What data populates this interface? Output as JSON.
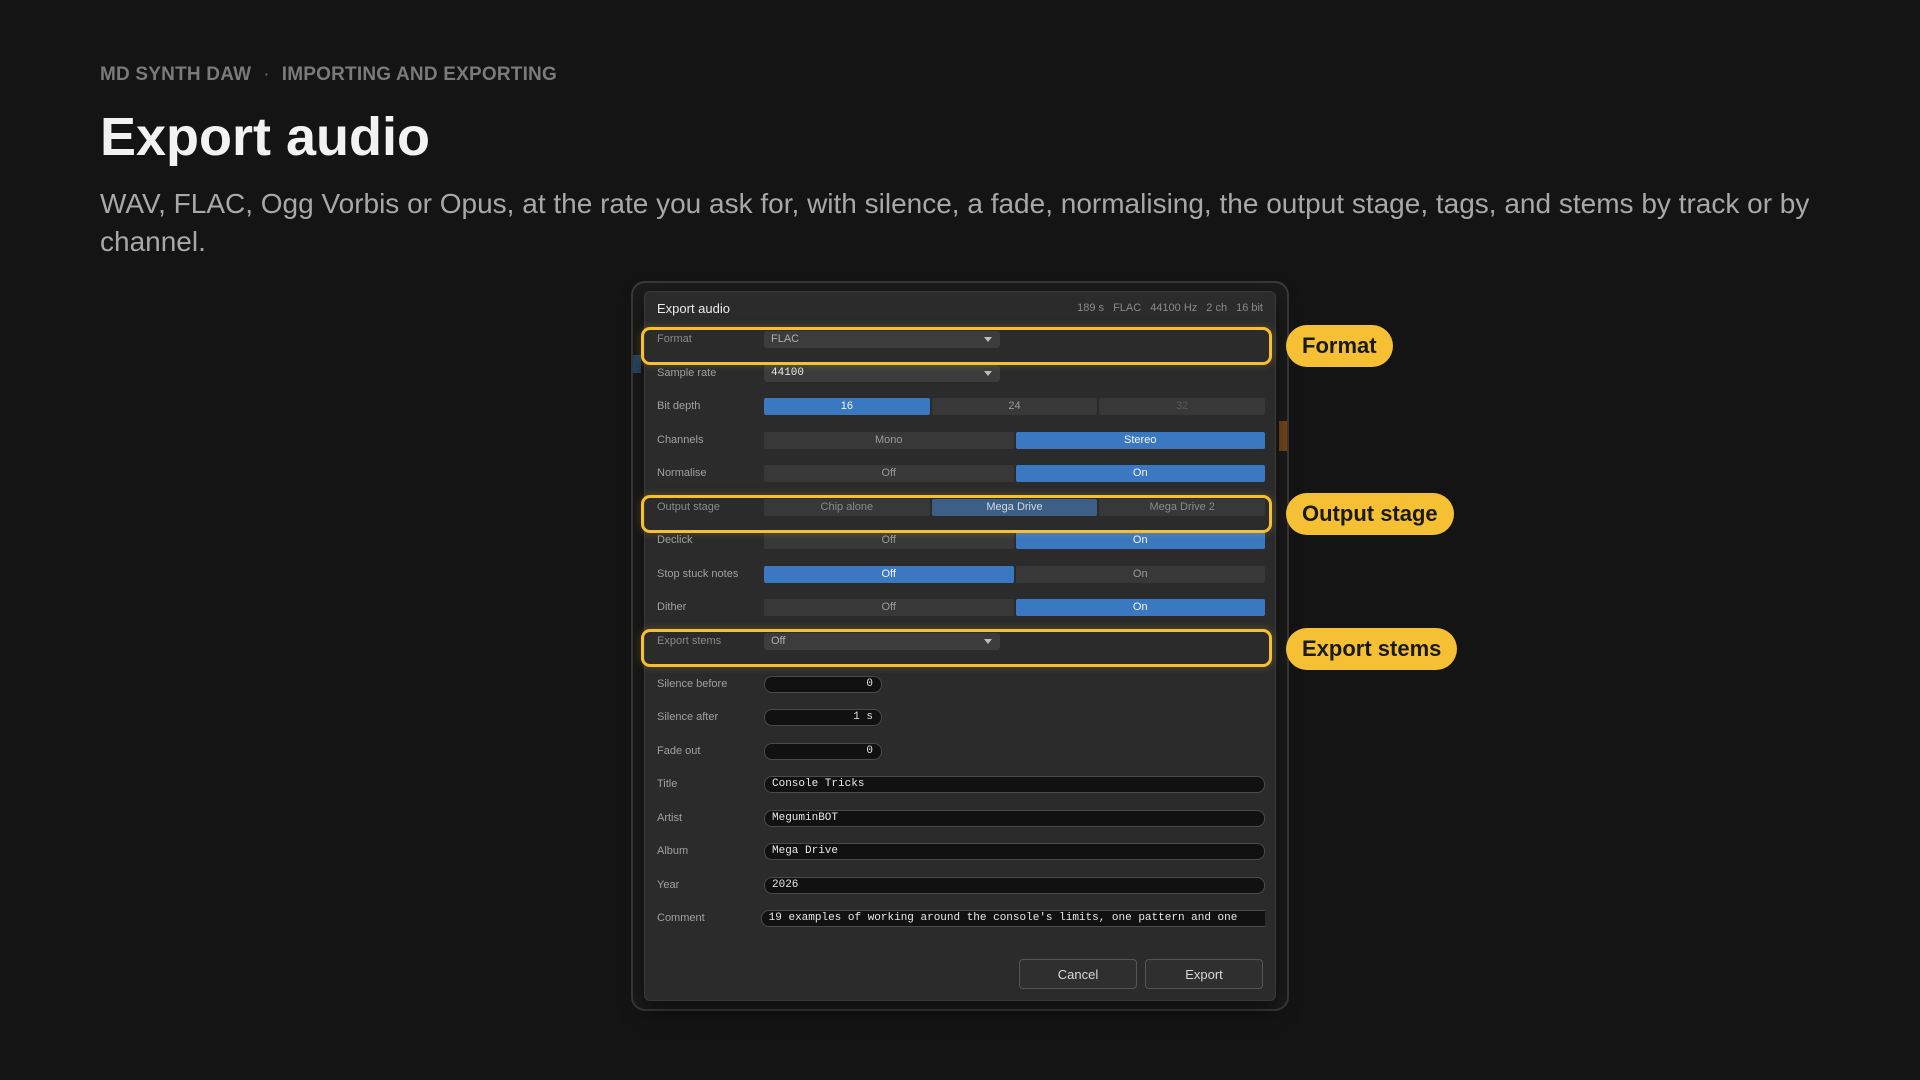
{
  "breadcrumb": {
    "app": "MD SYNTH DAW",
    "separator": "·",
    "section": "IMPORTING AND EXPORTING"
  },
  "page": {
    "title": "Export audio",
    "subtitle": "WAV, FLAC, Ogg Vorbis or Opus, at the rate you ask for, with silence, a fade, normalising, the output stage, tags, and stems by track or by channel."
  },
  "dialog": {
    "title": "Export audio",
    "meta": [
      "189 s",
      "FLAC",
      "44100 Hz",
      "2 ch",
      "16 bit"
    ],
    "format": {
      "label": "Format",
      "value": "FLAC"
    },
    "sample_rate": {
      "label": "Sample rate",
      "value": "44100"
    },
    "bit_depth": {
      "label": "Bit depth",
      "options": [
        "16",
        "24",
        "32"
      ],
      "selected": "16",
      "disabled": [
        "32"
      ]
    },
    "channels": {
      "label": "Channels",
      "options": [
        "Mono",
        "Stereo"
      ],
      "selected": "Stereo"
    },
    "normalise": {
      "label": "Normalise",
      "options": [
        "Off",
        "On"
      ],
      "selected": "On"
    },
    "output_stage": {
      "label": "Output stage",
      "options": [
        "Chip alone",
        "Mega Drive",
        "Mega Drive 2"
      ],
      "selected": "Mega Drive"
    },
    "declick": {
      "label": "Declick",
      "options": [
        "Off",
        "On"
      ],
      "selected": "On"
    },
    "stop_stuck_notes": {
      "label": "Stop stuck notes",
      "options": [
        "Off",
        "On"
      ],
      "selected": "Off"
    },
    "dither": {
      "label": "Dither",
      "options": [
        "Off",
        "On"
      ],
      "selected": "On"
    },
    "export_stems": {
      "label": "Export stems",
      "value": "Off"
    },
    "silence_before": {
      "label": "Silence before",
      "value": "0"
    },
    "silence_after": {
      "label": "Silence after",
      "value": "1 s"
    },
    "fade_out": {
      "label": "Fade out",
      "value": "0"
    },
    "tag_title": {
      "label": "Title",
      "value": "Console Tricks"
    },
    "tag_artist": {
      "label": "Artist",
      "value": "MeguminBOT"
    },
    "tag_album": {
      "label": "Album",
      "value": "Mega Drive"
    },
    "tag_year": {
      "label": "Year",
      "value": "2026"
    },
    "tag_comment": {
      "label": "Comment",
      "value": "19 examples of working around the console's limits, one pattern and one"
    },
    "cancel_label": "Cancel",
    "export_label": "Export"
  },
  "callouts": {
    "format": "Format",
    "output_stage": "Output stage",
    "export_stems": "Export stems"
  },
  "colors": {
    "accent": "#3b78c2",
    "highlight": "#f5c033",
    "background": "#141414"
  }
}
